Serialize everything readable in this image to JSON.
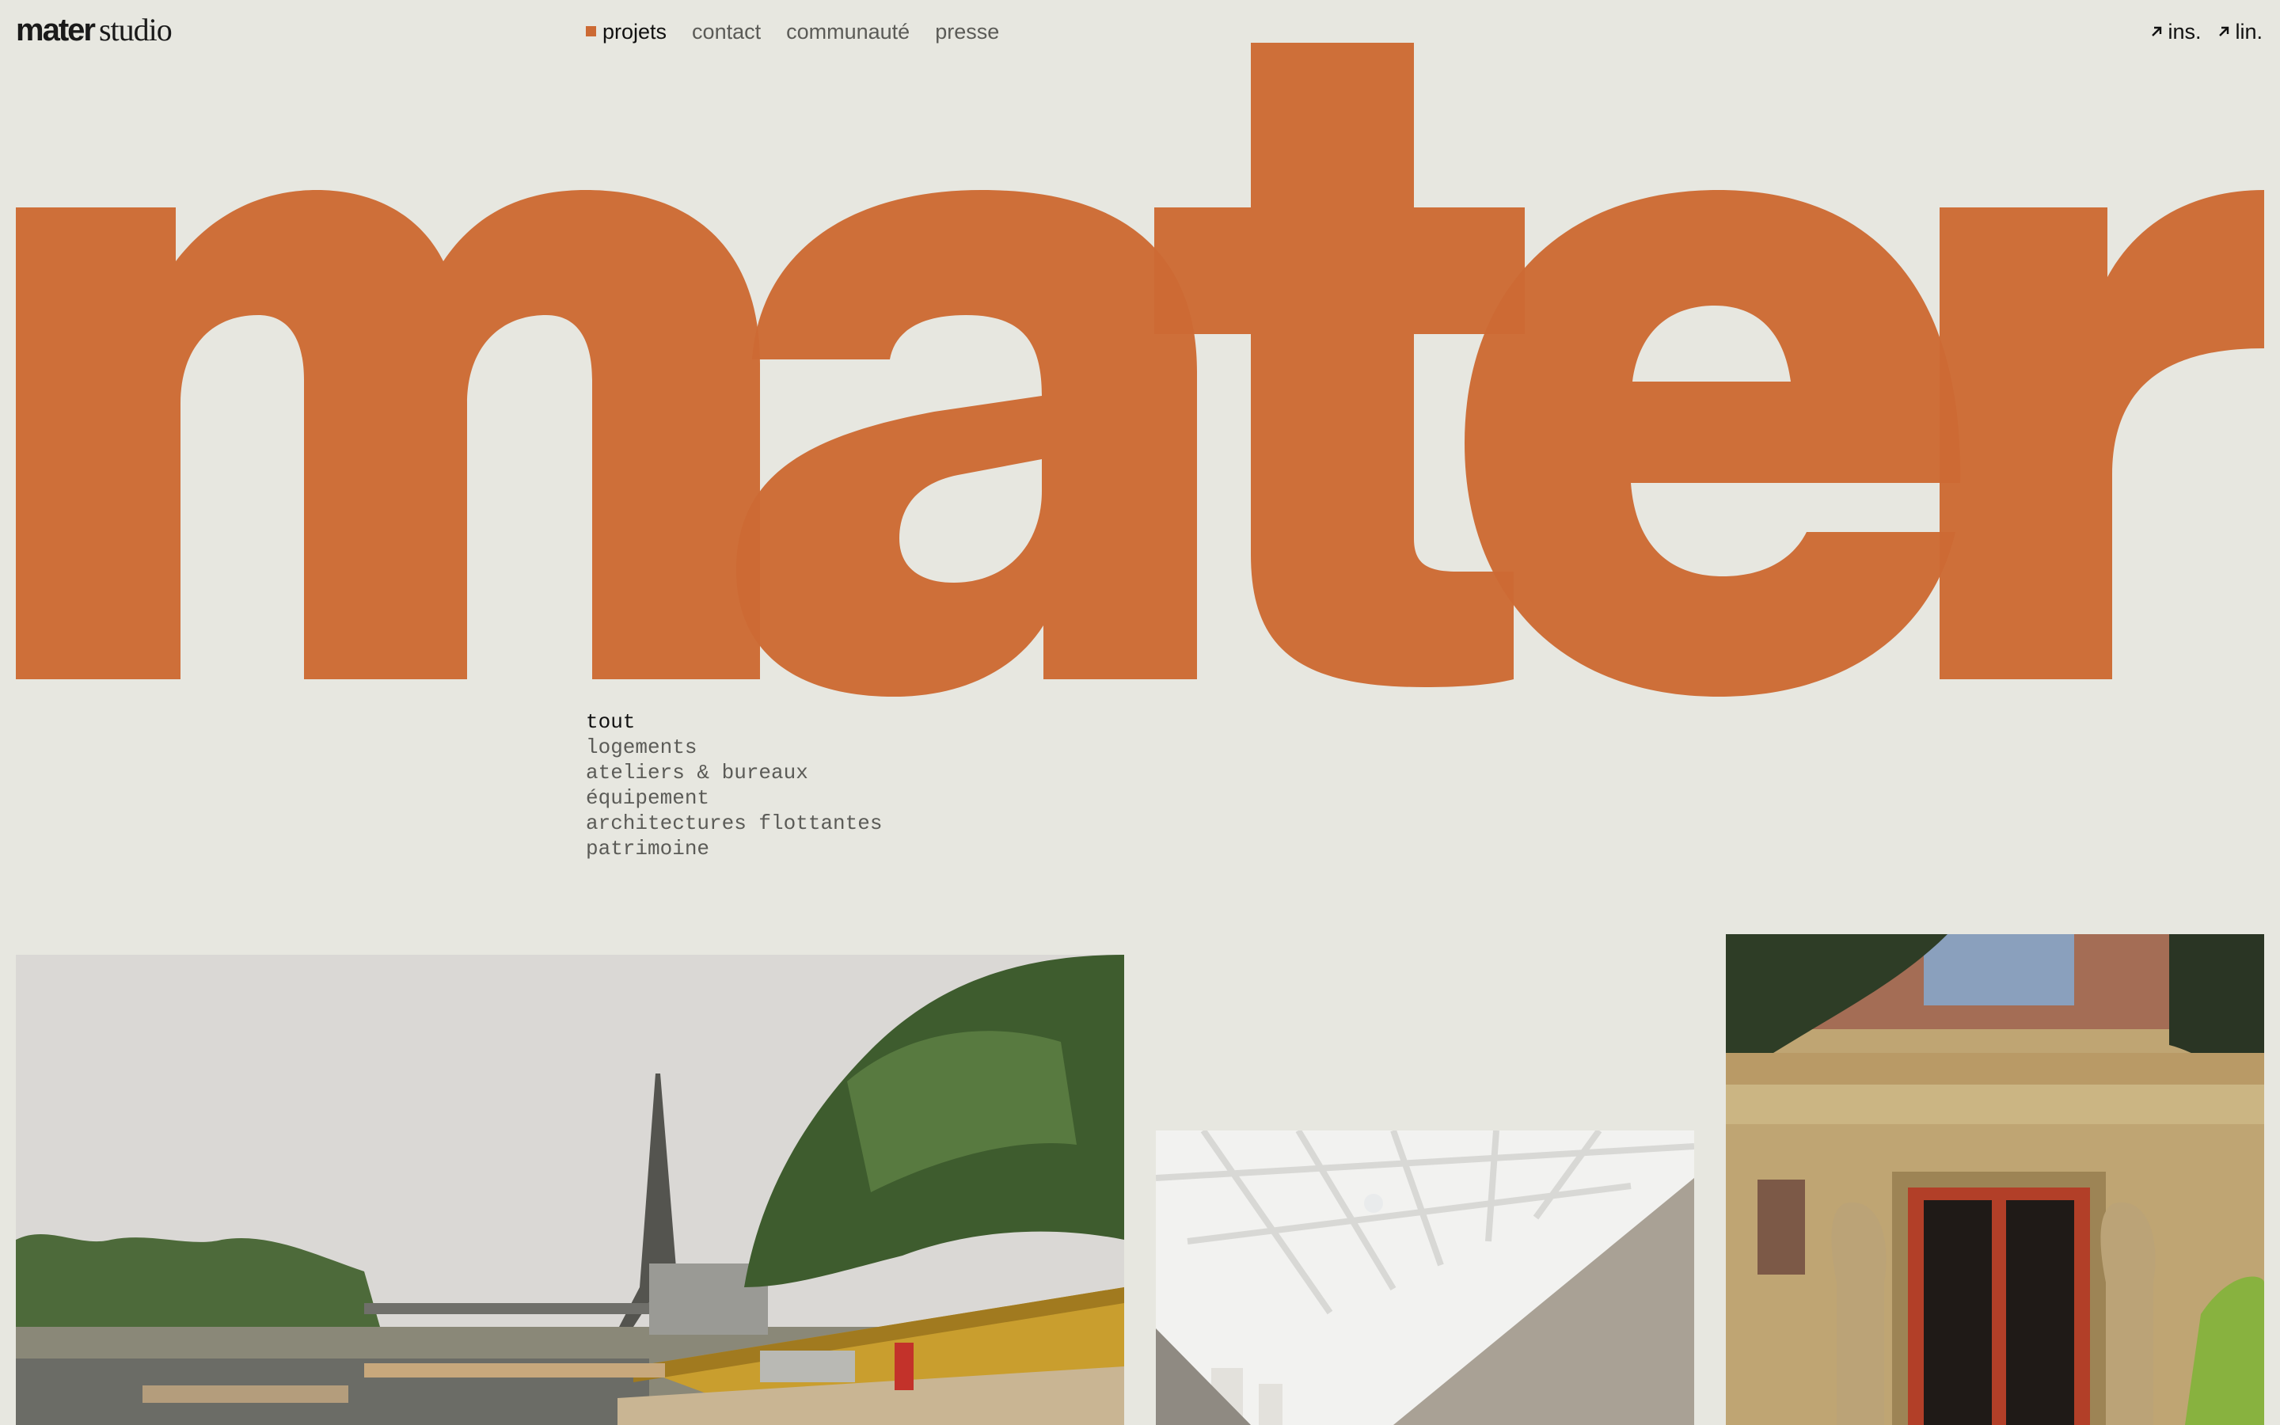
{
  "brand": {
    "name_bold": "mater",
    "name_light": "studio",
    "hero_word": "mater"
  },
  "nav": {
    "items": [
      {
        "label": "projets",
        "active": true
      },
      {
        "label": "contact"
      },
      {
        "label": "communauté"
      },
      {
        "label": "presse"
      }
    ]
  },
  "social": [
    {
      "label": "ins.",
      "icon": "arrow-up-right-icon"
    },
    {
      "label": "lin.",
      "icon": "arrow-up-right-icon"
    }
  ],
  "filters": {
    "active": "tout",
    "items": [
      "tout",
      "logements",
      "ateliers & bureaux",
      "équipement",
      "architectures flottantes",
      "patrimoine"
    ]
  },
  "colors": {
    "accent": "#cc6a34",
    "background": "#e7e7e0",
    "text": "#1a1a1a",
    "muted": "#5b5b57"
  }
}
